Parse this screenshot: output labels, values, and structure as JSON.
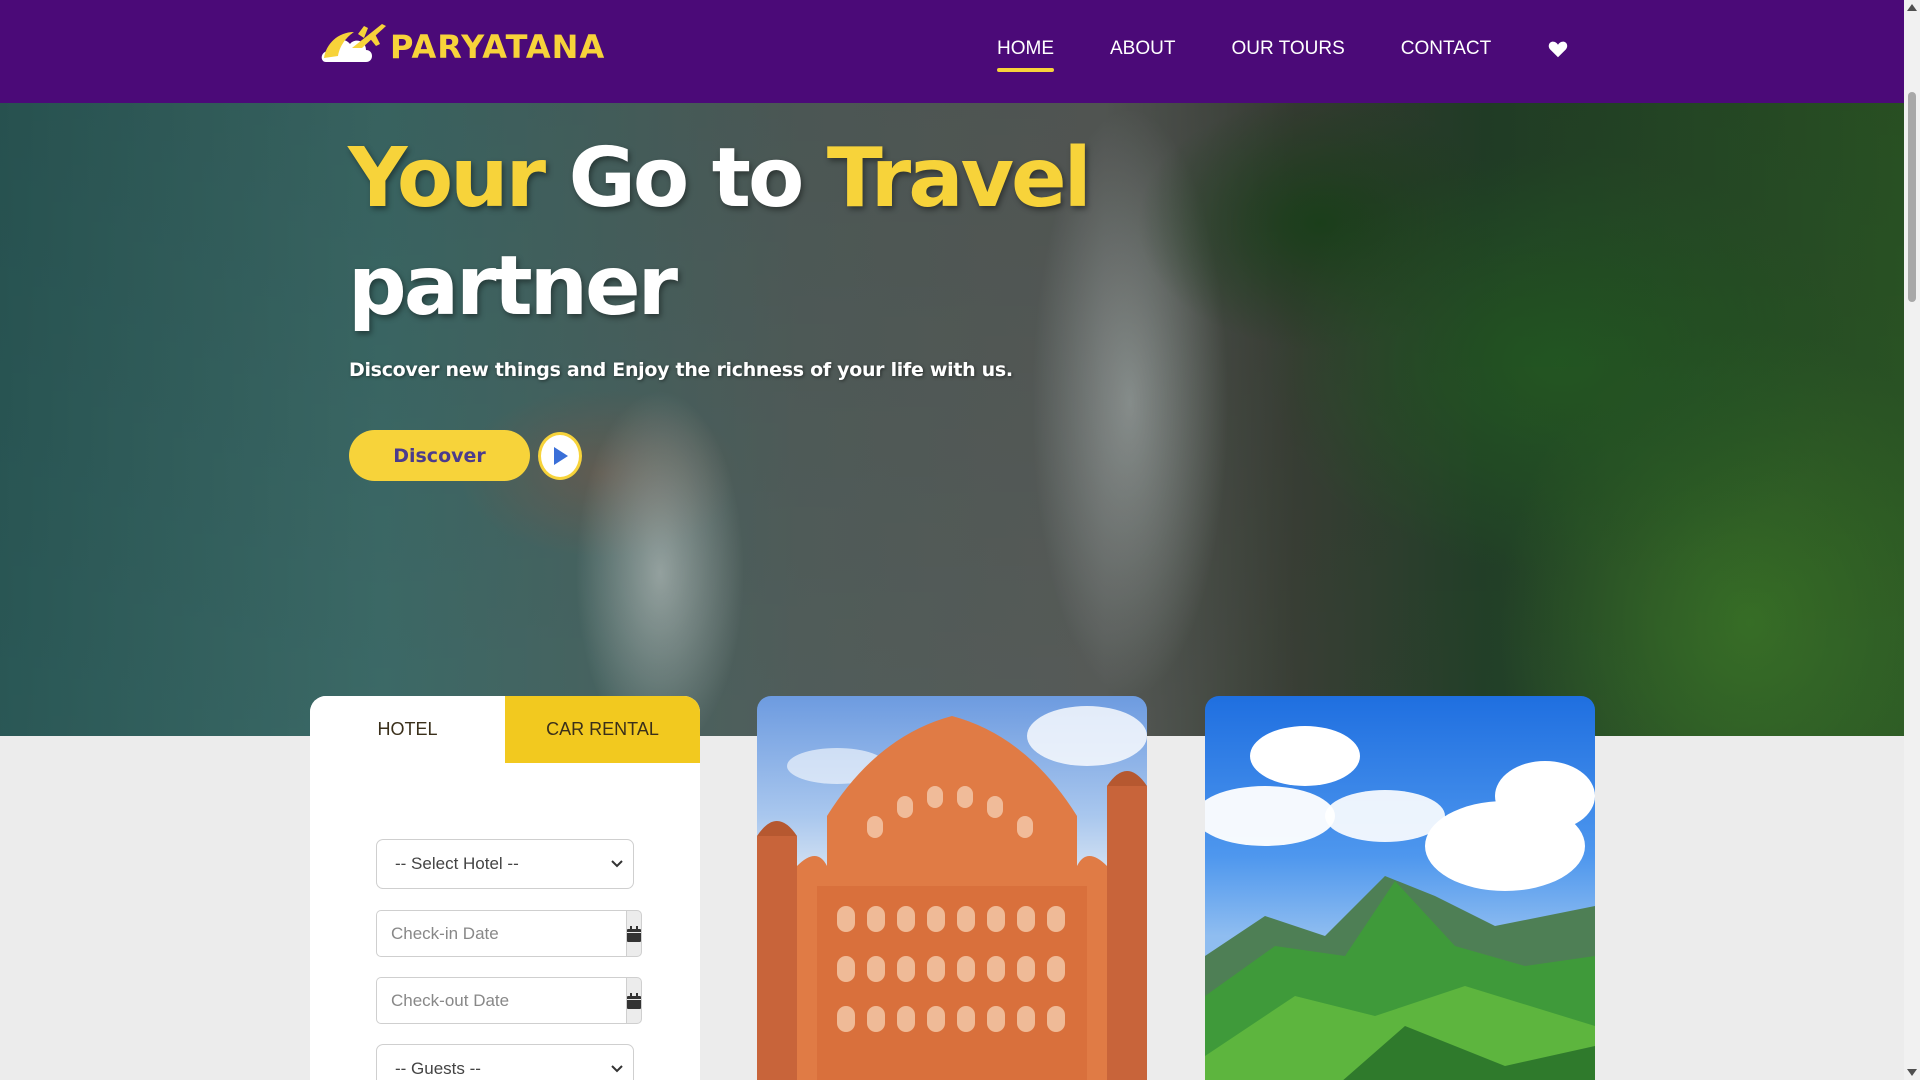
{
  "brand": {
    "name": "PARYATANA",
    "logo_icon": "airplane-cloud-icon"
  },
  "nav": {
    "items": [
      {
        "label": "HOME",
        "active": true
      },
      {
        "label": "ABOUT",
        "active": false
      },
      {
        "label": "OUR TOURS",
        "active": false
      },
      {
        "label": "CONTACT",
        "active": false
      }
    ],
    "wishlist_icon": "heart-icon"
  },
  "hero": {
    "title_word1": "Your",
    "title_word2": "Go to",
    "title_word3": "Travel",
    "title_word4": "partner",
    "subtitle": "Discover new things and Enjoy the richness of your life with us.",
    "discover_label": "Discover",
    "play_icon": "play-icon"
  },
  "booking": {
    "tabs": [
      {
        "label": "HOTEL",
        "active": true
      },
      {
        "label": "CAR RENTAL",
        "active": false
      }
    ],
    "hotel_select": "-- Select Hotel --",
    "checkin_placeholder": "Check-in Date",
    "checkout_placeholder": "Check-out Date",
    "calendar_icon": "calendar-icon",
    "guests_select": "-- Guests --"
  },
  "cards": [
    {
      "subject": "hawa-mahal-palace"
    },
    {
      "subject": "green-mountain-peak"
    }
  ],
  "colors": {
    "nav_bg": "#4b0a78",
    "accent_yellow": "#f7d33a",
    "tab_yellow": "#f2c91f",
    "page_bg": "#ececec"
  }
}
